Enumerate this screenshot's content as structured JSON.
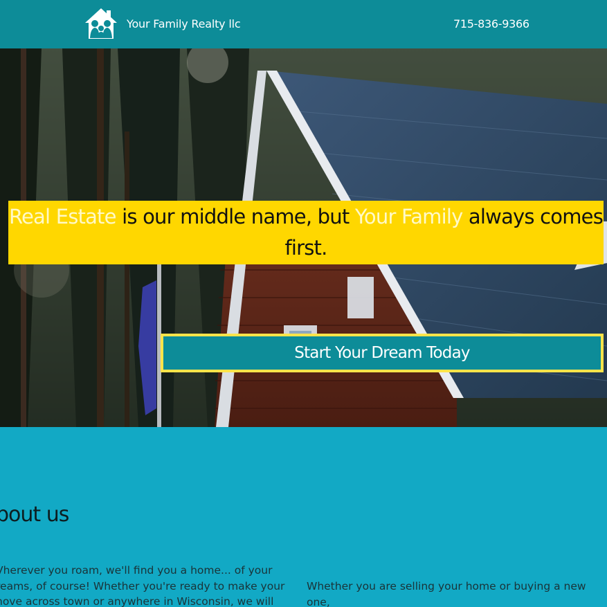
{
  "colors": {
    "header_bg": "#0d8c98",
    "headline_bg": "#ffd700",
    "cta_bg": "#0d8c98",
    "cta_border": "#ffe44a",
    "about_bg": "#12a9c5"
  },
  "header": {
    "logo_icon": "family-house-logo-icon",
    "brand": "Your Family Realty llc",
    "phone": "715-836-9366"
  },
  "hero": {
    "image": "house-with-blue-roof-among-pine-trees",
    "headline": {
      "part1": "Real Estate",
      "part2": " is our middle name, but ",
      "part3": "Your Family",
      "part4": " always comes first."
    },
    "cta_label": "Start Your Dream Today"
  },
  "about": {
    "title": "bout us",
    "left_text": "Vherever you roam, we'll find you a home... of your\nreams, of course! Whether you're ready to make your\nnove across town or anywhere in Wisconsin, we will",
    "right_text": "Whether you are selling your home or buying a new one,\nour personal service philosophy is to take care of all the"
  }
}
